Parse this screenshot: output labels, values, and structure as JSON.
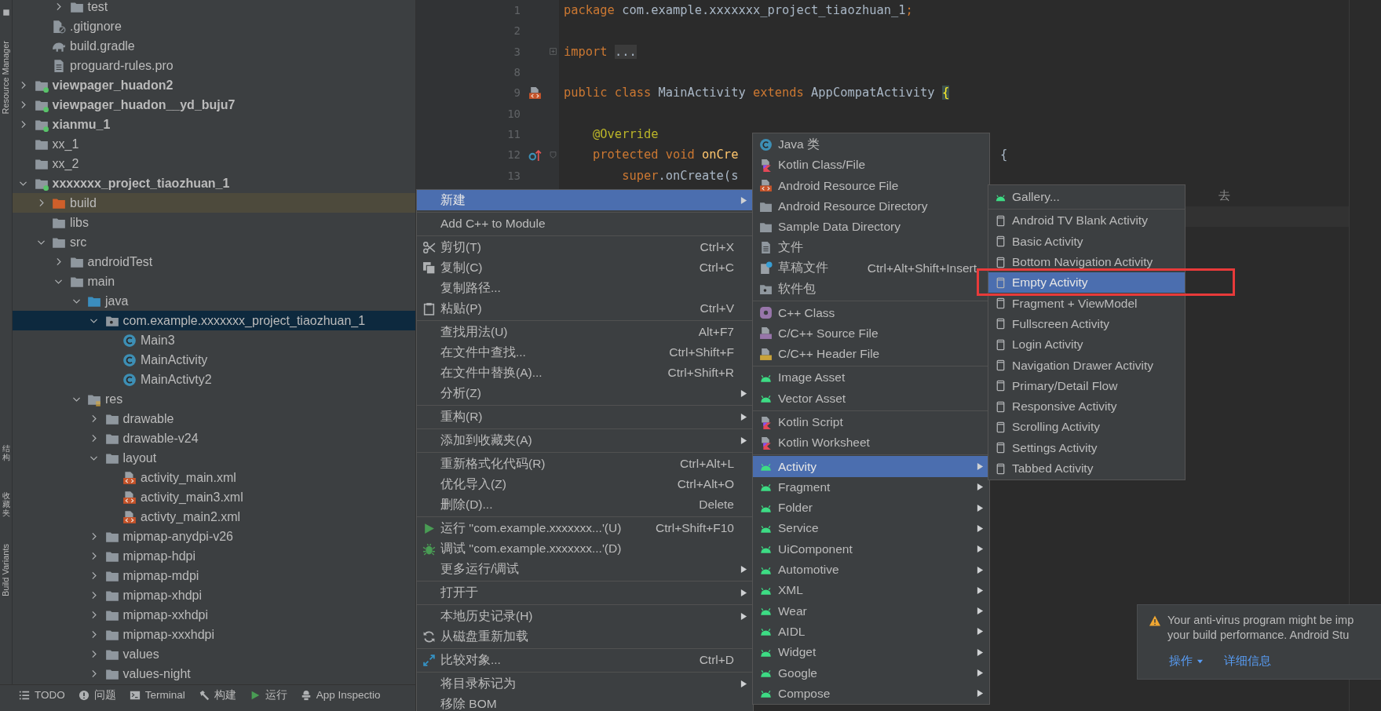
{
  "side_tools": [
    {
      "label": "Resource Manager",
      "kind": "latin"
    },
    {
      "label": "结构",
      "kind": "cjk"
    },
    {
      "label": "收藏夹",
      "kind": "cjk"
    },
    {
      "label": "Build Variants",
      "kind": "latin"
    }
  ],
  "tree": [
    {
      "children": [
        {
          "children": [
            {
              "label": "test",
              "kind": "folder",
              "expanded": false,
              "selected": false
            }
          ]
        },
        {
          "label": ".gitignore",
          "kind": "gitignore",
          "selected": false
        },
        {
          "label": "build.gradle",
          "kind": "gradle",
          "selected": false
        },
        {
          "label": "proguard-rules.pro",
          "kind": "text",
          "selected": false
        }
      ]
    },
    {
      "label": "viewpager_huadon2",
      "kind": "module",
      "expanded": false,
      "selected": false
    },
    {
      "label": "viewpager_huadon__yd_buju7",
      "kind": "module",
      "expanded": false,
      "selected": false
    },
    {
      "label": "xianmu_1",
      "kind": "module",
      "expanded": false,
      "selected": false
    },
    {
      "label": "xx_1",
      "kind": "folder",
      "selected": false
    },
    {
      "label": "xx_2",
      "kind": "folder",
      "selected": false
    },
    {
      "label": "xxxxxxx_project_tiaozhuan_1",
      "kind": "module",
      "expanded": true,
      "selected": false,
      "children": [
        {
          "label": "build",
          "kind": "excluded",
          "expanded": false,
          "selected": false
        },
        {
          "label": "libs",
          "kind": "folder",
          "selected": false
        },
        {
          "label": "src",
          "kind": "folder",
          "expanded": true,
          "selected": false,
          "children": [
            {
              "label": "androidTest",
              "kind": "folder",
              "expanded": false,
              "selected": false
            },
            {
              "label": "main",
              "kind": "folder",
              "expanded": true,
              "selected": false,
              "children": [
                {
                  "label": "java",
                  "kind": "java",
                  "expanded": true,
                  "selected": false,
                  "children": [
                    {
                      "label": "com.example.xxxxxxx_project_tiaozhuan_1",
                      "kind": "package",
                      "expanded": true,
                      "selected": true,
                      "children": [
                        {
                          "label": "Main3",
                          "kind": "class",
                          "selected": false
                        },
                        {
                          "label": "MainActivity",
                          "kind": "class",
                          "selected": false
                        },
                        {
                          "label": "MainActivty2",
                          "kind": "class",
                          "selected": false
                        }
                      ]
                    }
                  ]
                },
                {
                  "label": "res",
                  "kind": "res",
                  "expanded": true,
                  "selected": false,
                  "children": [
                    {
                      "label": "drawable",
                      "kind": "folder",
                      "expanded": false,
                      "selected": false
                    },
                    {
                      "label": "drawable-v24",
                      "kind": "folder",
                      "expanded": false,
                      "selected": false
                    },
                    {
                      "label": "layout",
                      "kind": "folder",
                      "expanded": true,
                      "selected": false,
                      "children": [
                        {
                          "label": "activity_main.xml",
                          "kind": "xml",
                          "selected": false
                        },
                        {
                          "label": "activity_main3.xml",
                          "kind": "xml",
                          "selected": false
                        },
                        {
                          "label": "activty_main2.xml",
                          "kind": "xml",
                          "selected": false
                        }
                      ]
                    },
                    {
                      "label": "mipmap-anydpi-v26",
                      "kind": "folder",
                      "expanded": false,
                      "selected": false
                    },
                    {
                      "label": "mipmap-hdpi",
                      "kind": "folder",
                      "expanded": false,
                      "selected": false
                    },
                    {
                      "label": "mipmap-mdpi",
                      "kind": "folder",
                      "expanded": false,
                      "selected": false
                    },
                    {
                      "label": "mipmap-xhdpi",
                      "kind": "folder",
                      "expanded": false,
                      "selected": false
                    },
                    {
                      "label": "mipmap-xxhdpi",
                      "kind": "folder",
                      "expanded": false,
                      "selected": false
                    },
                    {
                      "label": "mipmap-xxxhdpi",
                      "kind": "folder",
                      "expanded": false,
                      "selected": false
                    },
                    {
                      "label": "values",
                      "kind": "folder",
                      "expanded": false,
                      "selected": false
                    },
                    {
                      "label": "values-night",
                      "kind": "folder",
                      "expanded": false,
                      "selected": false
                    }
                  ]
                }
              ]
            }
          ]
        }
      ]
    }
  ],
  "bottom_toolbar": [
    {
      "label": "TODO",
      "kind": "list"
    },
    {
      "label": "问题",
      "kind": "problem"
    },
    {
      "label": "Terminal",
      "kind": "terminal"
    },
    {
      "label": "构建",
      "kind": "hammer"
    },
    {
      "label": "运行",
      "kind": "run"
    },
    {
      "label": "App Inspectio",
      "kind": "inspect"
    }
  ],
  "editor": {
    "lines": [
      {
        "number": "1",
        "kind": "code",
        "current": false,
        "segments": [
          {
            "kind": "keyword",
            "text": "package"
          },
          {
            "kind": "plain",
            "text": " com.example.xxxxxxx_project_tiaozhuan_1"
          },
          {
            "kind": "keyword",
            "text": ";"
          }
        ]
      },
      {
        "number": "2",
        "kind": "code",
        "current": false
      },
      {
        "number": "3",
        "kind": "folded-import",
        "current": false,
        "segments": [
          {
            "kind": "keyword",
            "text": "import"
          },
          {
            "kind": "folded",
            "text": "..."
          }
        ]
      },
      {
        "number": "8",
        "kind": "code",
        "current": false
      },
      {
        "number": "9",
        "kind": "layout-linked",
        "current": false,
        "segments": [
          {
            "kind": "keyword",
            "text": "public class"
          },
          {
            "kind": "plain",
            "text": " MainActivity "
          },
          {
            "kind": "keyword",
            "text": "extends"
          },
          {
            "kind": "plain",
            "text": " AppCompatActivity "
          },
          {
            "kind": "brace",
            "text": "{"
          }
        ]
      },
      {
        "number": "10",
        "kind": "code",
        "current": false
      },
      {
        "number": "11",
        "kind": "code",
        "current": false,
        "segments": [
          {
            "kind": "annotation",
            "text": "    @Override"
          }
        ]
      },
      {
        "number": "12",
        "kind": "override-method",
        "current": false,
        "segments": [
          {
            "kind": "keyword",
            "text": "    protected void"
          },
          {
            "kind": "method",
            "text": " onCre"
          },
          {
            "kind": "tail",
            "text": "{"
          }
        ]
      },
      {
        "number": "13",
        "kind": "code",
        "current": false,
        "segments": [
          {
            "kind": "keyword",
            "text": "        super"
          },
          {
            "kind": "plain",
            "text": ".onCreate(s"
          }
        ]
      },
      {
        "kind": "code",
        "current": false,
        "segments": [
          {
            "kind": "far",
            "text": "去"
          }
        ]
      },
      {
        "kind": "code",
        "current": true
      }
    ]
  },
  "context_menu": [
    {
      "kind": "plain",
      "label": "新建",
      "submenu": true,
      "selected": true
    },
    {
      "kind": "separator"
    },
    {
      "kind": "plain",
      "label": "Add C++ to Module",
      "submenu": false,
      "selected": false
    },
    {
      "kind": "separator"
    },
    {
      "kind": "scissors",
      "label": "剪切(T)",
      "shortcut": "Ctrl+X",
      "submenu": false,
      "selected": false
    },
    {
      "kind": "copy",
      "label": "复制(C)",
      "shortcut": "Ctrl+C",
      "submenu": false,
      "selected": false
    },
    {
      "kind": "plain",
      "label": "复制路径...",
      "submenu": false,
      "selected": false
    },
    {
      "kind": "paste",
      "label": "粘贴(P)",
      "shortcut": "Ctrl+V",
      "submenu": false,
      "selected": false
    },
    {
      "kind": "separator"
    },
    {
      "kind": "plain",
      "label": "查找用法(U)",
      "shortcut": "Alt+F7",
      "submenu": false,
      "selected": false
    },
    {
      "kind": "plain",
      "label": "在文件中查找...",
      "shortcut": "Ctrl+Shift+F",
      "submenu": false,
      "selected": false
    },
    {
      "kind": "plain",
      "label": "在文件中替换(A)...",
      "shortcut": "Ctrl+Shift+R",
      "submenu": false,
      "selected": false
    },
    {
      "kind": "plain",
      "label": "分析(Z)",
      "submenu": true,
      "selected": false
    },
    {
      "kind": "separator"
    },
    {
      "kind": "plain",
      "label": "重构(R)",
      "submenu": true,
      "selected": false
    },
    {
      "kind": "separator"
    },
    {
      "kind": "plain",
      "label": "添加到收藏夹(A)",
      "submenu": true,
      "selected": false
    },
    {
      "kind": "separator"
    },
    {
      "kind": "plain",
      "label": "重新格式化代码(R)",
      "shortcut": "Ctrl+Alt+L",
      "submenu": false,
      "selected": false
    },
    {
      "kind": "plain",
      "label": "优化导入(Z)",
      "shortcut": "Ctrl+Alt+O",
      "submenu": false,
      "selected": false
    },
    {
      "kind": "plain",
      "label": "删除(D)...",
      "shortcut": "Delete",
      "submenu": false,
      "selected": false
    },
    {
      "kind": "separator"
    },
    {
      "kind": "run",
      "label": "运行 ''com.example.xxxxxxx...'(U)",
      "shortcut": "Ctrl+Shift+F10",
      "submenu": false,
      "selected": false
    },
    {
      "kind": "debug",
      "label": "调试 ''com.example.xxxxxxx...'(D)",
      "submenu": false,
      "selected": false
    },
    {
      "kind": "plain",
      "label": "更多运行/调试",
      "submenu": true,
      "selected": false
    },
    {
      "kind": "separator"
    },
    {
      "kind": "plain",
      "label": "打开于",
      "submenu": true,
      "selected": false
    },
    {
      "kind": "separator"
    },
    {
      "kind": "plain",
      "label": "本地历史记录(H)",
      "submenu": true,
      "selected": false
    },
    {
      "kind": "reload",
      "label": "从磁盘重新加载",
      "submenu": false,
      "selected": false
    },
    {
      "kind": "separator"
    },
    {
      "kind": "compare",
      "label": "比较对象...",
      "shortcut": "Ctrl+D",
      "submenu": false,
      "selected": false
    },
    {
      "kind": "separator"
    },
    {
      "kind": "plain",
      "label": "将目录标记为",
      "submenu": true,
      "selected": false
    },
    {
      "kind": "plain",
      "label": "移除 BOM",
      "submenu": false,
      "selected": false
    }
  ],
  "new_submenu": [
    {
      "kind": "class",
      "label": "Java 类",
      "submenu": false,
      "selected": false
    },
    {
      "kind": "kotlin",
      "label": "Kotlin Class/File",
      "submenu": false,
      "selected": false
    },
    {
      "kind": "xml",
      "label": "Android Resource File",
      "submenu": false,
      "selected": false
    },
    {
      "kind": "folder",
      "label": "Android Resource Directory",
      "submenu": false,
      "selected": false
    },
    {
      "kind": "folder",
      "label": "Sample Data Directory",
      "submenu": false,
      "selected": false
    },
    {
      "kind": "text-file",
      "label": "文件",
      "submenu": false,
      "selected": false
    },
    {
      "kind": "scratch",
      "label": "草稿文件",
      "shortcut": "Ctrl+Alt+Shift+Insert",
      "submenu": false,
      "selected": false
    },
    {
      "kind": "package",
      "label": "软件包",
      "submenu": false,
      "selected": false
    },
    {
      "kind": "separator"
    },
    {
      "kind": "cppclass",
      "label": "C++ Class",
      "submenu": false,
      "selected": false
    },
    {
      "kind": "cpp",
      "label": "C/C++ Source File",
      "submenu": false,
      "selected": false
    },
    {
      "kind": "header",
      "label": "C/C++ Header File",
      "submenu": false,
      "selected": false
    },
    {
      "kind": "separator"
    },
    {
      "kind": "android",
      "label": "Image Asset",
      "submenu": false,
      "selected": false
    },
    {
      "kind": "android",
      "label": "Vector Asset",
      "submenu": false,
      "selected": false
    },
    {
      "kind": "separator"
    },
    {
      "kind": "kotlin",
      "label": "Kotlin Script",
      "submenu": false,
      "selected": false
    },
    {
      "kind": "kotlin",
      "label": "Kotlin Worksheet",
      "submenu": false,
      "selected": false
    },
    {
      "kind": "separator"
    },
    {
      "kind": "android",
      "label": "Activity",
      "submenu": true,
      "selected": true
    },
    {
      "kind": "android",
      "label": "Fragment",
      "submenu": true,
      "selected": false
    },
    {
      "kind": "android",
      "label": "Folder",
      "submenu": true,
      "selected": false
    },
    {
      "kind": "android",
      "label": "Service",
      "submenu": true,
      "selected": false
    },
    {
      "kind": "android",
      "label": "UiComponent",
      "submenu": true,
      "selected": false
    },
    {
      "kind": "android",
      "label": "Automotive",
      "submenu": true,
      "selected": false
    },
    {
      "kind": "android",
      "label": "XML",
      "submenu": true,
      "selected": false
    },
    {
      "kind": "android",
      "label": "Wear",
      "submenu": true,
      "selected": false
    },
    {
      "kind": "android",
      "label": "AIDL",
      "submenu": true,
      "selected": false
    },
    {
      "kind": "android",
      "label": "Widget",
      "submenu": true,
      "selected": false
    },
    {
      "kind": "android",
      "label": "Google",
      "submenu": true,
      "selected": false
    },
    {
      "kind": "android",
      "label": "Compose",
      "submenu": true,
      "selected": false
    }
  ],
  "activity_submenu": [
    {
      "kind": "android",
      "label": "Gallery...",
      "selected": false
    },
    {
      "kind": "separator"
    },
    {
      "kind": "phone",
      "label": "Android TV Blank Activity",
      "selected": false
    },
    {
      "kind": "phone",
      "label": "Basic Activity",
      "selected": false
    },
    {
      "kind": "phone",
      "label": "Bottom Navigation Activity",
      "selected": false
    },
    {
      "kind": "phone",
      "label": "Empty Activity",
      "selected": true
    },
    {
      "kind": "phone",
      "label": "Fragment + ViewModel",
      "selected": false
    },
    {
      "kind": "phone",
      "label": "Fullscreen Activity",
      "selected": false
    },
    {
      "kind": "phone",
      "label": "Login Activity",
      "selected": false
    },
    {
      "kind": "phone",
      "label": "Navigation Drawer Activity",
      "selected": false
    },
    {
      "kind": "phone",
      "label": "Primary/Detail Flow",
      "selected": false
    },
    {
      "kind": "phone",
      "label": "Responsive Activity",
      "selected": false
    },
    {
      "kind": "phone",
      "label": "Scrolling Activity",
      "selected": false
    },
    {
      "kind": "phone",
      "label": "Settings Activity",
      "selected": false
    },
    {
      "kind": "phone",
      "label": "Tabbed Activity",
      "selected": false
    }
  ],
  "annotation": {
    "kind": "rectangle"
  },
  "notification": {
    "lines": [
      "Your anti-virus program might be imp",
      "your build performance. Android Stu"
    ],
    "actions": [
      {
        "label": "操作",
        "dropdown": true
      },
      {
        "label": "详细信息",
        "dropdown": false
      }
    ]
  }
}
